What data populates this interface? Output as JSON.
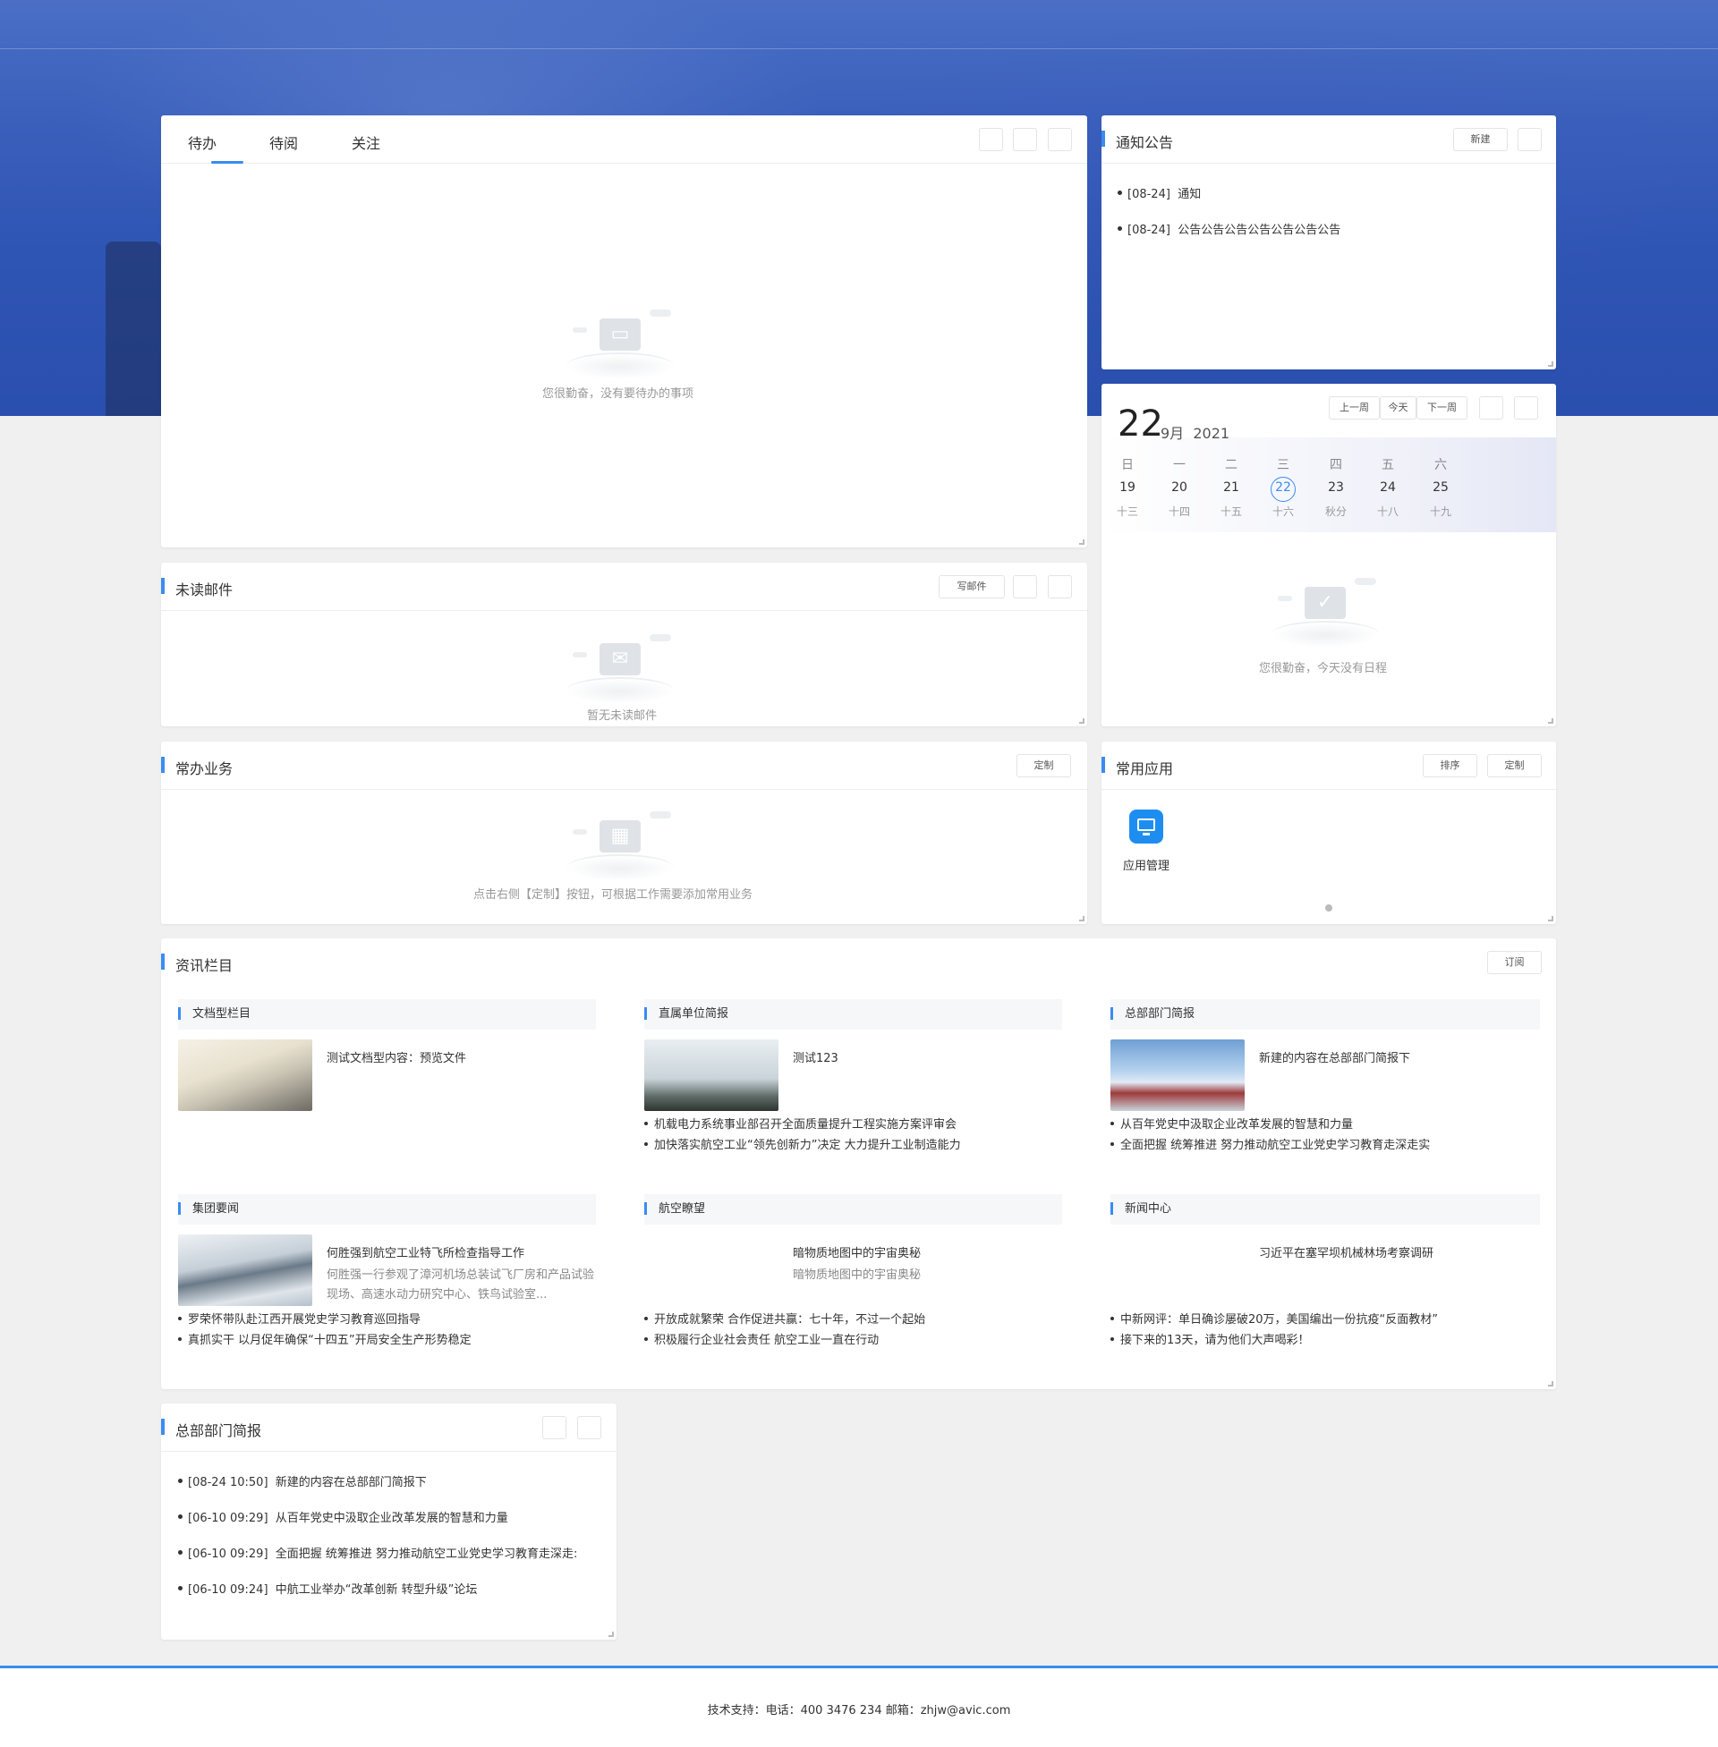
{
  "todo": {
    "tabs": [
      "待办",
      "待阅",
      "关注"
    ],
    "empty": "您很勤奋，没有要待办的事项"
  },
  "notice": {
    "title": "通知公告",
    "new_btn": "新建",
    "items": [
      {
        "date": "[08-24]",
        "text": "通知"
      },
      {
        "date": "[08-24]",
        "text": "公告公告公告公告公告公告公告"
      }
    ]
  },
  "calendar": {
    "day": "22",
    "month": "9月",
    "year": "2021",
    "prev_btn": "上一周",
    "today_btn": "今天",
    "next_btn": "下一周",
    "weekdays": [
      "日",
      "一",
      "二",
      "三",
      "四",
      "五",
      "六"
    ],
    "days": [
      "19",
      "20",
      "21",
      "22",
      "23",
      "24",
      "25"
    ],
    "lunar": [
      "十三",
      "十四",
      "十五",
      "十六",
      "秋分",
      "十八",
      "十九"
    ],
    "today_index": 3,
    "empty": "您很勤奋，今天没有日程"
  },
  "mail": {
    "title": "未读邮件",
    "write_btn": "写邮件",
    "empty": "暂无未读邮件"
  },
  "business": {
    "title": "常办业务",
    "custom_btn": "定制",
    "empty": "点击右侧【定制】按钮，可根据工作需要添加常用业务"
  },
  "apps": {
    "title": "常用应用",
    "sort_btn": "排序",
    "custom_btn": "定制",
    "items": [
      {
        "label": "应用管理",
        "icon": "monitor-icon"
      }
    ]
  },
  "news": {
    "title": "资讯栏目",
    "subscribe_btn": "订阅",
    "columns": [
      {
        "head": "文档型栏目",
        "title": "测试文档型内容：预览文件",
        "desc": "",
        "items": []
      },
      {
        "head": "直属单位简报",
        "title": "测试123",
        "desc": "",
        "items": [
          "机载电力系统事业部召开全面质量提升工程实施方案评审会",
          "加快落实航空工业“领先创新力”决定 大力提升工业制造能力"
        ]
      },
      {
        "head": "总部部门简报",
        "title": "新建的内容在总部部门简报下",
        "desc": "",
        "items": [
          "从百年党史中汲取企业改革发展的智慧和力量",
          "全面把握 统筹推进 努力推动航空工业党史学习教育走深走实"
        ]
      },
      {
        "head": "集团要闻",
        "title": "何胜强到航空工业特飞所检查指导工作",
        "desc": "何胜强一行参观了漳河机场总装试飞厂房和产品试验现场、高速水动力研究中心、铁鸟试验室...",
        "items": [
          "罗荣怀带队赴江西开展党史学习教育巡回指导",
          "真抓实干 以月促年确保“十四五”开局安全生产形势稳定"
        ]
      },
      {
        "head": "航空瞭望",
        "title": "暗物质地图中的宇宙奥秘",
        "desc": "暗物质地图中的宇宙奥秘",
        "items": [
          "开放成就繁荣 合作促进共赢：七十年，不过一个起始",
          "积极履行企业社会责任 航空工业一直在行动"
        ]
      },
      {
        "head": "新闻中心",
        "title": "习近平在塞罕坝机械林场考察调研",
        "desc": "",
        "items": [
          "中新网评：单日确诊屡破20万，美国编出一份抗疫“反面教材”",
          "接下来的13天，请为他们大声喝彩！"
        ]
      }
    ]
  },
  "brief": {
    "title": "总部部门简报",
    "items": [
      {
        "date": "[08-24 10:50]",
        "text": "新建的内容在总部部门简报下"
      },
      {
        "date": "[06-10 09:29]",
        "text": "从百年党史中汲取企业改革发展的智慧和力量"
      },
      {
        "date": "[06-10 09:29]",
        "text": "全面把握 统筹推进 努力推动航空工业党史学习教育走深走:"
      },
      {
        "date": "[06-10 09:24]",
        "text": "中航工业举办“改革创新 转型升级”论坛"
      }
    ]
  },
  "footer": {
    "text": "技术支持：电话：400 3476 234 邮箱：zhjw@avic.com"
  }
}
